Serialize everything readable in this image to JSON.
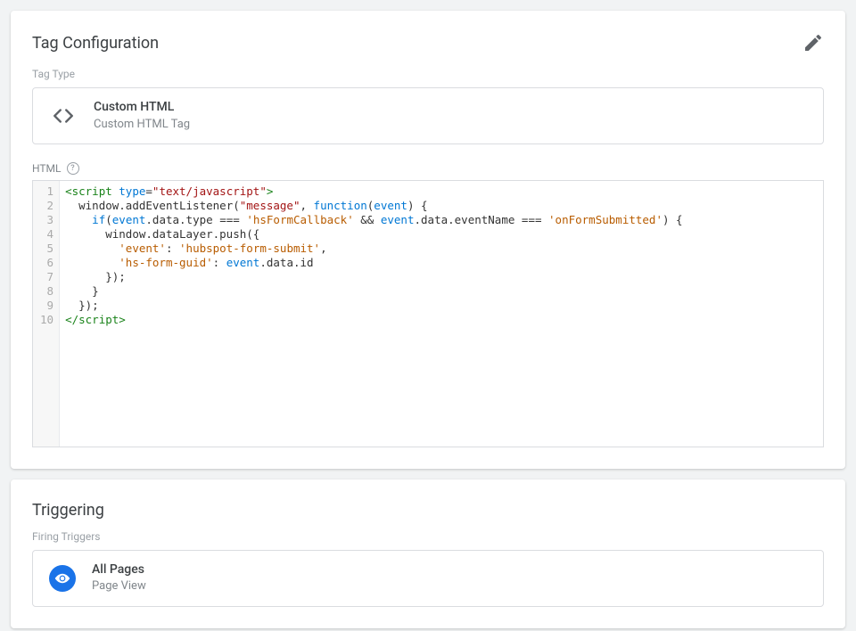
{
  "tagConfig": {
    "title": "Tag Configuration",
    "tagTypeLabel": "Tag Type",
    "type": {
      "name": "Custom HTML",
      "subtitle": "Custom HTML Tag"
    },
    "htmlLabel": "HTML",
    "code": [
      {
        "num": "1",
        "tokens": [
          {
            "t": "<",
            "c": "tok-tag"
          },
          {
            "t": "script",
            "c": "tok-tag"
          },
          {
            "t": " ",
            "c": "tok-plain"
          },
          {
            "t": "type",
            "c": "tok-attr"
          },
          {
            "t": "=",
            "c": "tok-plain"
          },
          {
            "t": "\"text/javascript\"",
            "c": "tok-str"
          },
          {
            "t": ">",
            "c": "tok-tag"
          }
        ]
      },
      {
        "num": "2",
        "tokens": [
          {
            "t": "  ",
            "c": "tok-plain"
          },
          {
            "t": "window.addEventListener(",
            "c": "tok-plain"
          },
          {
            "t": "\"message\"",
            "c": "tok-str"
          },
          {
            "t": ", ",
            "c": "tok-plain"
          },
          {
            "t": "function",
            "c": "tok-kw"
          },
          {
            "t": "(",
            "c": "tok-plain"
          },
          {
            "t": "event",
            "c": "tok-prop"
          },
          {
            "t": ") {",
            "c": "tok-plain"
          }
        ]
      },
      {
        "num": "3",
        "tokens": [
          {
            "t": "    ",
            "c": "tok-plain"
          },
          {
            "t": "if",
            "c": "tok-kw"
          },
          {
            "t": "(",
            "c": "tok-plain"
          },
          {
            "t": "event",
            "c": "tok-prop"
          },
          {
            "t": ".data.type ",
            "c": "tok-plain"
          },
          {
            "t": "===",
            "c": "tok-plain"
          },
          {
            "t": " ",
            "c": "tok-plain"
          },
          {
            "t": "'hsFormCallback'",
            "c": "tok-js-str"
          },
          {
            "t": " ",
            "c": "tok-plain"
          },
          {
            "t": "&&",
            "c": "tok-plain"
          },
          {
            "t": " ",
            "c": "tok-plain"
          },
          {
            "t": "event",
            "c": "tok-prop"
          },
          {
            "t": ".data.eventName ",
            "c": "tok-plain"
          },
          {
            "t": "===",
            "c": "tok-plain"
          },
          {
            "t": " ",
            "c": "tok-plain"
          },
          {
            "t": "'onFormSubmitted'",
            "c": "tok-js-str"
          },
          {
            "t": ") {",
            "c": "tok-plain"
          }
        ]
      },
      {
        "num": "4",
        "tokens": [
          {
            "t": "      window.dataLayer.push({",
            "c": "tok-plain"
          }
        ]
      },
      {
        "num": "5",
        "tokens": [
          {
            "t": "        ",
            "c": "tok-plain"
          },
          {
            "t": "'event'",
            "c": "tok-js-str"
          },
          {
            "t": ": ",
            "c": "tok-plain"
          },
          {
            "t": "'hubspot-form-submit'",
            "c": "tok-js-str"
          },
          {
            "t": ",",
            "c": "tok-plain"
          }
        ]
      },
      {
        "num": "6",
        "tokens": [
          {
            "t": "        ",
            "c": "tok-plain"
          },
          {
            "t": "'hs-form-guid'",
            "c": "tok-js-str"
          },
          {
            "t": ": ",
            "c": "tok-plain"
          },
          {
            "t": "event",
            "c": "tok-prop"
          },
          {
            "t": ".data.id",
            "c": "tok-plain"
          }
        ]
      },
      {
        "num": "7",
        "tokens": [
          {
            "t": "      });",
            "c": "tok-plain"
          }
        ]
      },
      {
        "num": "8",
        "tokens": [
          {
            "t": "    }",
            "c": "tok-plain"
          }
        ]
      },
      {
        "num": "9",
        "tokens": [
          {
            "t": "  });",
            "c": "tok-plain"
          }
        ]
      },
      {
        "num": "10",
        "tokens": [
          {
            "t": "</",
            "c": "tok-tag"
          },
          {
            "t": "script",
            "c": "tok-tag"
          },
          {
            "t": ">",
            "c": "tok-tag"
          }
        ]
      }
    ]
  },
  "triggering": {
    "title": "Triggering",
    "firingLabel": "Firing Triggers",
    "trigger": {
      "name": "All Pages",
      "subtitle": "Page View"
    }
  }
}
